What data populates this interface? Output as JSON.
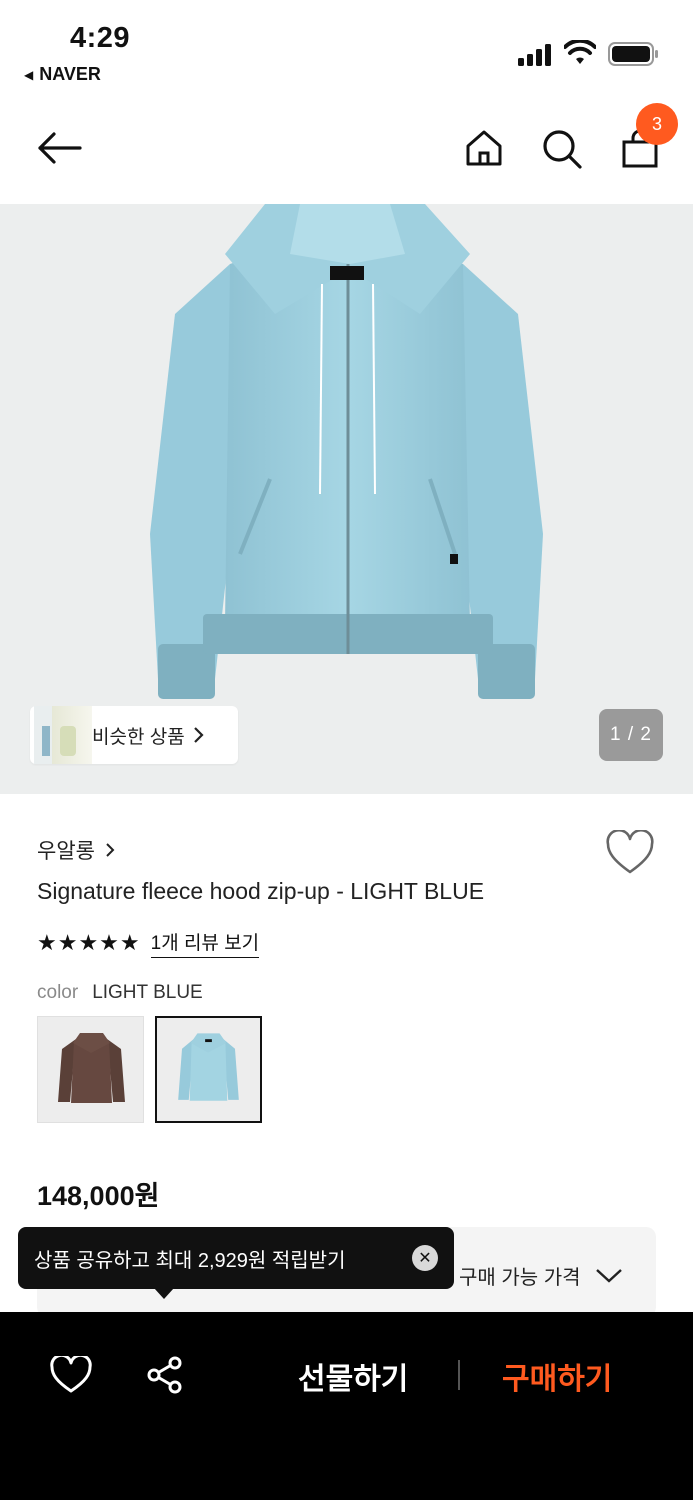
{
  "status_bar": {
    "time": "4:29",
    "back_app": "NAVER"
  },
  "header": {
    "cart_count": "3"
  },
  "gallery": {
    "similar_label": "비슷한 상품",
    "pager": "1 / 2",
    "product_color_hex": "#9fd0df"
  },
  "product": {
    "brand": "우알롱",
    "title": "Signature fleece hood zip-up - LIGHT BLUE",
    "stars": "★★★★★",
    "review_link": "1개 리뷰 보기",
    "color_key": "color",
    "color_value": "LIGHT BLUE",
    "price": "148,000원"
  },
  "swatches": [
    {
      "name": "brown",
      "hex": "#5a4038"
    },
    {
      "name": "light-blue",
      "hex": "#9fd0df"
    }
  ],
  "purchase": {
    "avail_label": "구매 가능 가격"
  },
  "tooltip": {
    "text": "상품 공유하고 최대 2,929원 적립받기"
  },
  "bottom_bar": {
    "gift_label": "선물하기",
    "buy_label": "구매하기"
  },
  "colors": {
    "accent": "#ff5a1f",
    "bar": "#000000"
  }
}
